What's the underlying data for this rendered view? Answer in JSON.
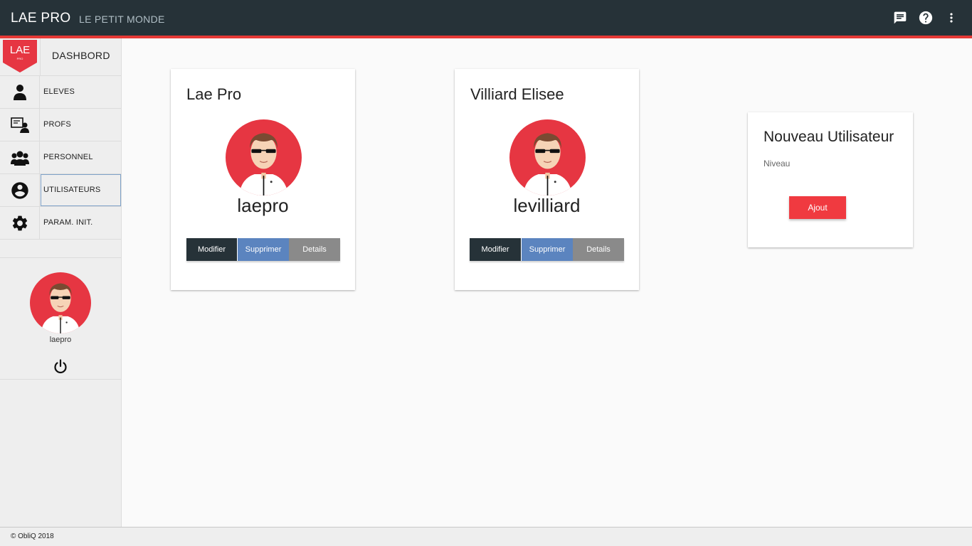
{
  "header": {
    "title": "LAE PRO",
    "subtitle": "LE PETIT MONDE",
    "icons": [
      "chat-icon",
      "help-icon",
      "more-vert-icon"
    ],
    "accent_color": "#e53935",
    "bar_color": "#263238"
  },
  "sidebar": {
    "logo_text": "LAE",
    "logo_subtext": "PRO",
    "dashboard_label": "DASHBORD",
    "items": [
      {
        "label": "ELEVES",
        "icon": "student-icon"
      },
      {
        "label": "PROFS",
        "icon": "teacher-icon"
      },
      {
        "label": "PERSONNEL",
        "icon": "group-icon"
      },
      {
        "label": "UTILISATEURS",
        "icon": "account-circle-icon",
        "active": true
      },
      {
        "label": "PARAM. INIT.",
        "icon": "gear-icon"
      }
    ],
    "user": {
      "name": "laepro"
    }
  },
  "users": [
    {
      "full_name": "Lae Pro",
      "login": "laepro"
    },
    {
      "full_name": "Villiard Elisee",
      "login": "levilliard"
    }
  ],
  "buttons": {
    "modify": "Modifier",
    "delete": "Supprimer",
    "details": "Details"
  },
  "new_user": {
    "title": "Nouveau Utilisateur",
    "level_label": "Niveau",
    "add_button": "Ajout"
  },
  "footer": {
    "text": "© ObliQ 2018"
  }
}
